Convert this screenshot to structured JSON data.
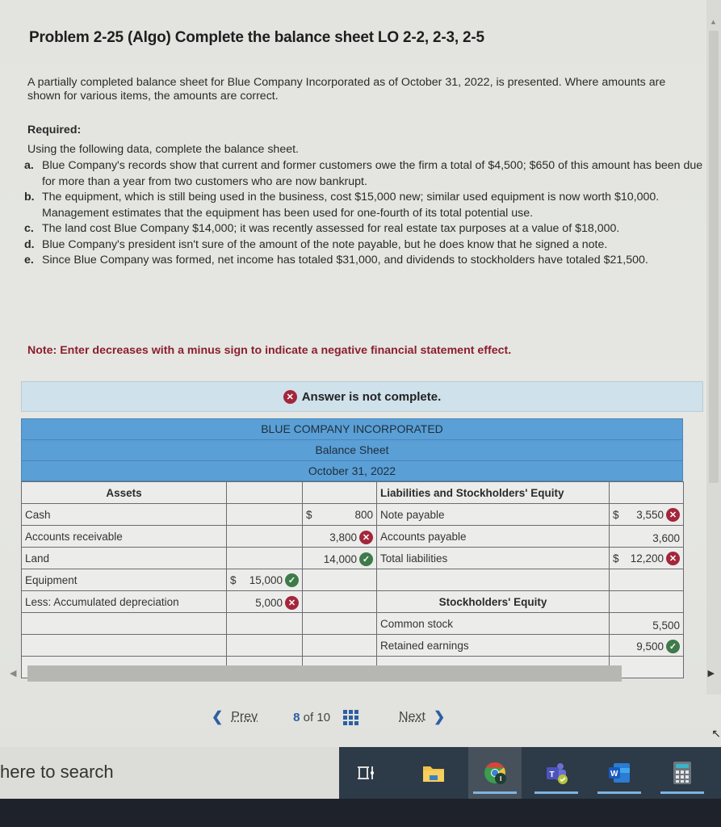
{
  "problem": {
    "title": "Problem 2-25 (Algo) Complete the balance sheet LO 2-2, 2-3, 2-5",
    "intro": "A partially completed balance sheet for Blue Company Incorporated as of October 31, 2022, is presented. Where amounts are shown for various items, the amounts are correct.",
    "required_label": "Required:",
    "instruction": "Using the following data, complete the balance sheet.",
    "items": [
      {
        "letter": "a.",
        "text": "Blue Company's records show that current and former customers owe the firm a total of $4,500; $650 of this amount has been due for more than a year from two customers who are now bankrupt."
      },
      {
        "letter": "b.",
        "text": "The equipment, which is still being used in the business, cost $15,000 new; similar used equipment is now worth $10,000. Management estimates that the equipment has been used for one-fourth of its total potential use."
      },
      {
        "letter": "c.",
        "text": "The land cost Blue Company $14,000; it was recently assessed for real estate tax purposes at a value of $18,000."
      },
      {
        "letter": "d.",
        "text": "Blue Company's president isn't sure of the amount of the note payable, but he does know that he signed a note."
      },
      {
        "letter": "e.",
        "text": "Since Blue Company was formed, net income has totaled $31,000, and dividends to stockholders have totaled $21,500."
      }
    ],
    "note": "Note: Enter decreases with a minus sign to indicate a negative financial statement effect."
  },
  "answer_status": {
    "text": "Answer is not complete.",
    "icon": "x-circle-icon"
  },
  "balance_sheet": {
    "company": "BLUE COMPANY INCORPORATED",
    "statement": "Balance Sheet",
    "date": "October 31, 2022",
    "assets_header": "Assets",
    "liabilities_header": "Liabilities and Stockholders' Equity",
    "equity_header": "Stockholders' Equity",
    "rows": [
      {
        "asset": "Cash",
        "a1": "",
        "a1_dollar": "",
        "a1_mark": "",
        "a2": "800",
        "a2_dollar": "$",
        "a2_mark": "",
        "liab": "Note payable",
        "l": "3,550",
        "l_dollar": "$",
        "l_mark": "wrong"
      },
      {
        "asset": "Accounts receivable",
        "a1": "",
        "a1_dollar": "",
        "a1_mark": "",
        "a2": "3,800",
        "a2_dollar": "",
        "a2_mark": "wrong",
        "liab": "Accounts payable",
        "l": "3,600",
        "l_dollar": "",
        "l_mark": ""
      },
      {
        "asset": "Land",
        "a1": "",
        "a1_dollar": "",
        "a1_mark": "",
        "a2": "14,000",
        "a2_dollar": "",
        "a2_mark": "correct",
        "liab": "Total liabilities",
        "l": "12,200",
        "l_dollar": "$",
        "l_mark": "wrong"
      },
      {
        "asset": "Equipment",
        "a1": "15,000",
        "a1_dollar": "$",
        "a1_mark": "correct",
        "a2": "",
        "a2_dollar": "",
        "a2_mark": "",
        "liab": "",
        "l": "",
        "l_dollar": "",
        "l_mark": ""
      },
      {
        "asset": "Less: Accumulated depreciation",
        "a1": "5,000",
        "a1_dollar": "",
        "a1_mark": "wrong",
        "a2": "",
        "a2_dollar": "",
        "a2_mark": "",
        "liab": "Stockholders' Equity",
        "l": "",
        "l_dollar": "",
        "l_mark": ""
      },
      {
        "asset": "",
        "a1": "",
        "a1_dollar": "",
        "a1_mark": "",
        "a2": "",
        "a2_dollar": "",
        "a2_mark": "",
        "liab": "Common stock",
        "l": "5,500",
        "l_dollar": "",
        "l_mark": ""
      },
      {
        "asset": "",
        "a1": "",
        "a1_dollar": "",
        "a1_mark": "",
        "a2": "",
        "a2_dollar": "",
        "a2_mark": "",
        "liab": "Retained earnings",
        "l": "9,500",
        "l_dollar": "",
        "l_mark": "correct"
      }
    ]
  },
  "pager": {
    "prev_label": "Prev",
    "current": "8",
    "of_label": "of 10",
    "next_label": "Next"
  },
  "taskbar": {
    "search_placeholder": "here to search",
    "apps": [
      "task-view",
      "file-explorer",
      "chrome",
      "teams",
      "word",
      "calculator"
    ]
  },
  "colors": {
    "header_blue": "#5a9fd6",
    "wrong_red": "#a4263b",
    "correct_green": "#3e7a4a",
    "note_red": "#8b1e2e",
    "link_blue": "#2c5fa3"
  }
}
